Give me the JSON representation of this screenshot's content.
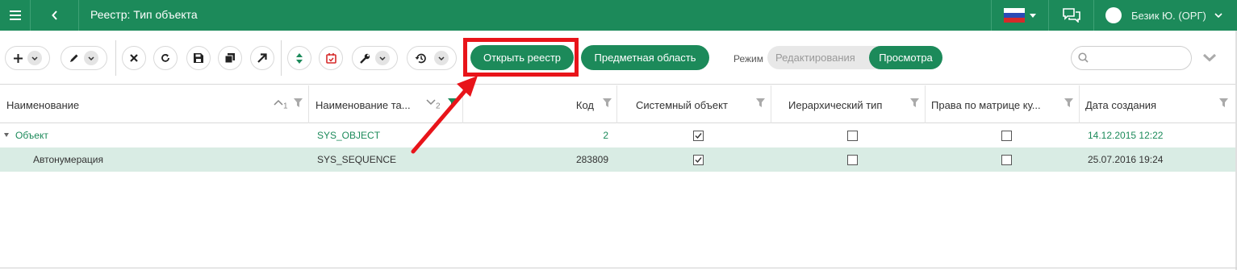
{
  "header": {
    "title": "Реестр: Тип объекта",
    "user_name": "Безик Ю. (ОРГ)"
  },
  "toolbar": {
    "open_registry_label": "Открыть реестр",
    "subject_area_label": "Предметная область",
    "mode_label": "Режим",
    "mode_edit_label": "Редактирования",
    "mode_view_label": "Просмотра",
    "mode_selected": "Просмотра",
    "search_placeholder": ""
  },
  "table": {
    "columns": [
      {
        "label": "Наименование",
        "sort_index": "1",
        "sort": "asc"
      },
      {
        "label": "Наименование та...",
        "sort_index": "2",
        "sort": "desc"
      },
      {
        "label": "Код"
      },
      {
        "label": "Системный объект"
      },
      {
        "label": "Иерархический тип"
      },
      {
        "label": "Права по матрице ку..."
      },
      {
        "label": "Дата создания"
      }
    ],
    "rows": [
      {
        "name": "Объект",
        "table_name": "SYS_OBJECT",
        "code": "2",
        "system": true,
        "hierarchical": false,
        "matrix_rights": false,
        "created": "14.12.2015 12:22",
        "selected": false
      },
      {
        "name": "Автонумерация",
        "table_name": "SYS_SEQUENCE",
        "code": "283809",
        "system": true,
        "hierarchical": false,
        "matrix_rights": false,
        "created": "25.07.2016 19:24",
        "selected": true
      }
    ]
  },
  "colors": {
    "brand": "#1c8a5a",
    "highlight": "#e8141a",
    "selected_row": "#d9ece4"
  }
}
